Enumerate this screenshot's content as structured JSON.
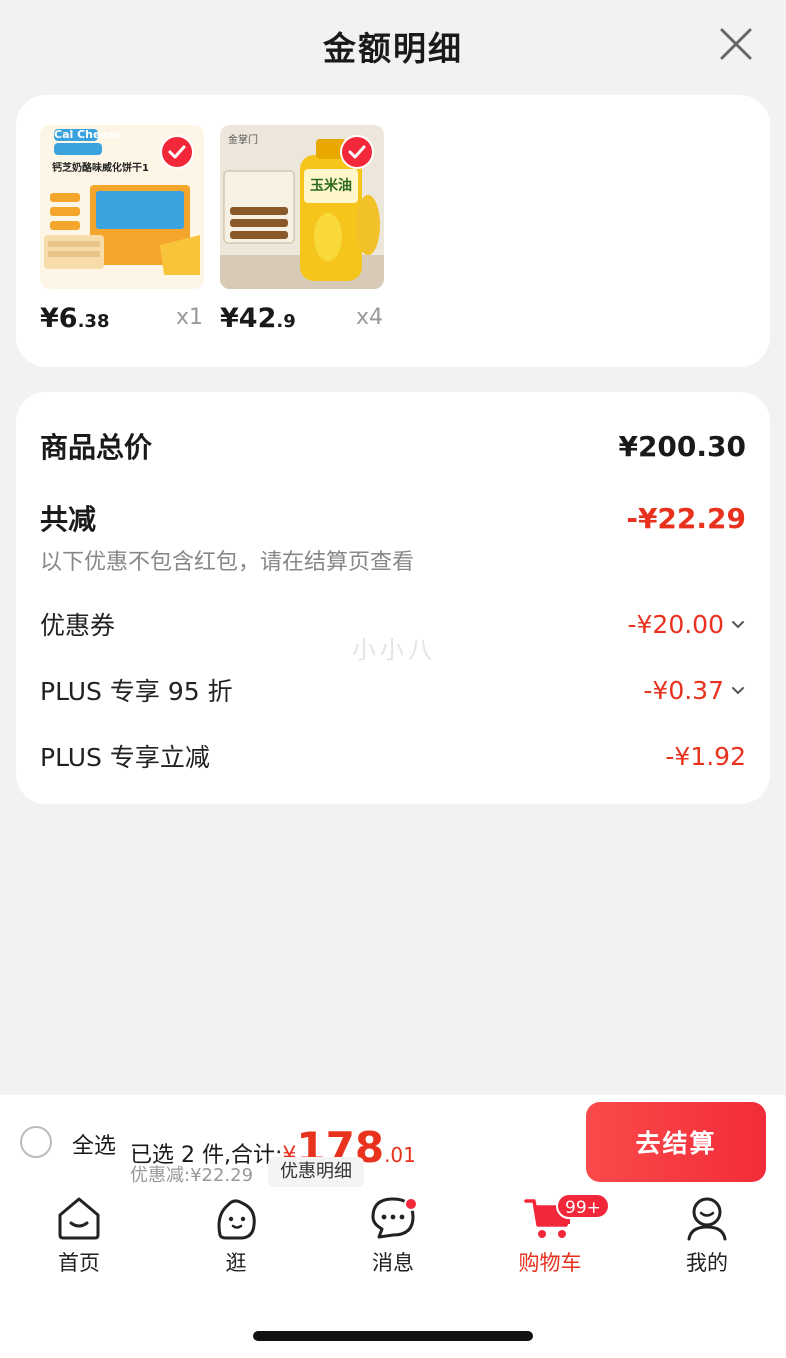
{
  "sheet": {
    "title": "金额明细",
    "close_icon": "close-icon"
  },
  "products": [
    {
      "price_int": "¥6",
      "price_dec": ".38",
      "qty": "x1",
      "icon": "cheese-wafer-image"
    },
    {
      "price_int": "¥42",
      "price_dec": ".9",
      "qty": "x4",
      "icon": "corn-oil-image"
    }
  ],
  "product_images": {
    "p1_brand": "Cal Cheese",
    "p1_name": "钙芝奶酪味威化饼干1",
    "p2_brand": "金掌门",
    "p2_name": "玉米油"
  },
  "summary": {
    "total_label": "商品总价",
    "total_value": "¥200.30",
    "discount_label": "共减",
    "discount_value": "-¥22.29",
    "note": "以下优惠不包含红包，请在结算页查看",
    "items": [
      {
        "label": "优惠券",
        "value": "-¥20.00",
        "expandable": true
      },
      {
        "label": "PLUS 专享 95 折",
        "value": "-¥0.37",
        "expandable": true
      },
      {
        "label": "PLUS 专享立减",
        "value": "-¥1.92",
        "expandable": false
      }
    ],
    "watermark": "小小八"
  },
  "bottom_bar": {
    "select_all_label": "全选",
    "selected_text": "已选 2 件,合计:",
    "total_yen": "¥",
    "total_int": "178",
    "total_dec": ".01",
    "discount_line": "优惠减:¥22.29",
    "detail_button": "优惠明细",
    "checkout_button": "去结算"
  },
  "tabbar": {
    "items": [
      {
        "label": "首页",
        "icon": "home-icon"
      },
      {
        "label": "逛",
        "icon": "explore-face-icon"
      },
      {
        "label": "消息",
        "icon": "message-icon"
      },
      {
        "label": "购物车",
        "icon": "cart-icon",
        "badge": "99+",
        "active": true
      },
      {
        "label": "我的",
        "icon": "profile-icon"
      }
    ]
  },
  "colors": {
    "accent_red": "#e8321e",
    "badge_red": "#f2283a",
    "background": "#f2f2f2"
  }
}
